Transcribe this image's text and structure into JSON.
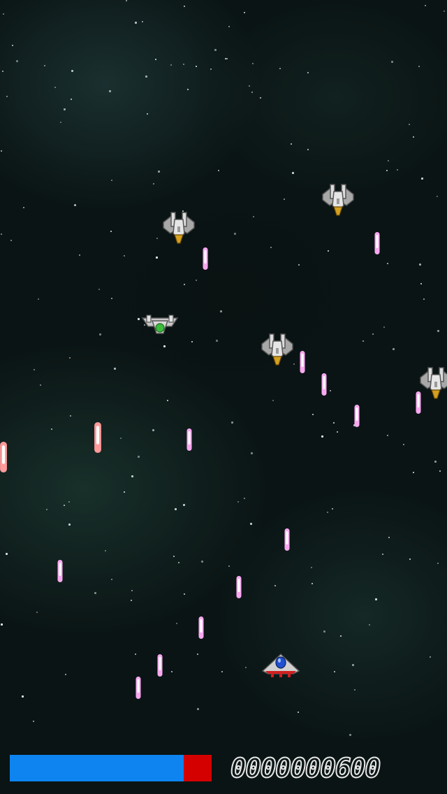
{
  "hud": {
    "health_level": 0.86,
    "health_color": "#0d84f0",
    "damage_color": "#d40000",
    "score": "0000000600"
  },
  "colors": {
    "enemy_bullet": "#f8a8f0",
    "player_bullet": "#ff9a9a",
    "enemy_hull": "#c8c8c8",
    "enemy_thruster": "#d4a020",
    "player_cockpit": "#2050d0",
    "player_trim": "#d02020"
  },
  "sprites": {
    "enemies": [
      "grey-fighter",
      "grey-fighter",
      "green-scout",
      "grey-fighter",
      "grey-fighter"
    ],
    "player": "player-ship"
  }
}
